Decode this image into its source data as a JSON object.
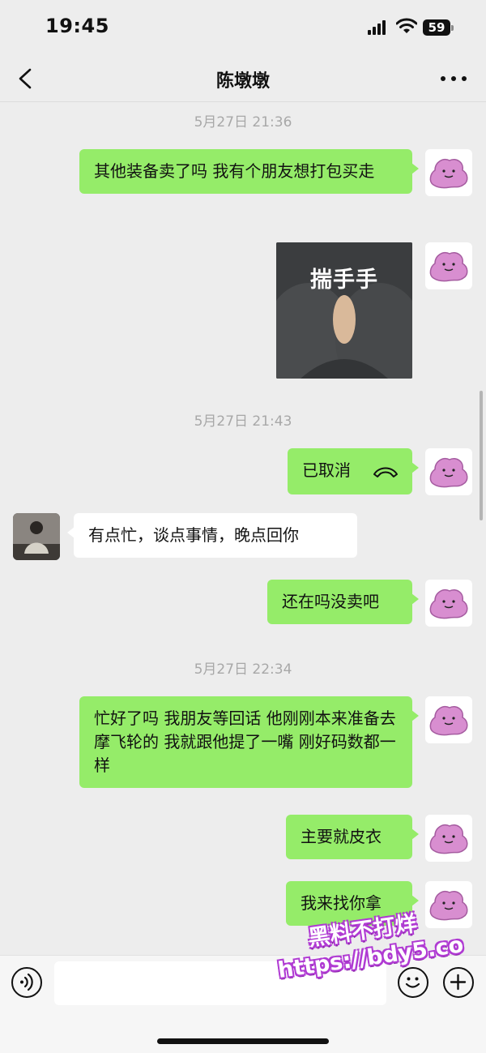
{
  "status_bar": {
    "time": "19:45",
    "battery": "59"
  },
  "nav": {
    "title": "陈墩墩"
  },
  "chat": {
    "timestamps": [
      "5月27日 21:36",
      "5月27日 21:43",
      "5月27日 22:34"
    ],
    "messages": [
      {
        "side": "out",
        "text": "其他装备卖了吗 我有个朋友想打包买走"
      },
      {
        "side": "out",
        "type": "sticker",
        "caption": "揣手手"
      },
      {
        "side": "out",
        "type": "call",
        "text": "已取消"
      },
      {
        "side": "in",
        "text": "有点忙，谈点事情，晚点回你"
      },
      {
        "side": "out",
        "text": "还在吗没卖吧"
      },
      {
        "side": "out",
        "text": "忙好了吗 我朋友等回话 他刚刚本来准备去摩飞轮的 我就跟他提了一嘴 刚好码数都一样"
      },
      {
        "side": "out",
        "text": "主要就皮衣"
      },
      {
        "side": "out",
        "text": "我来找你拿"
      }
    ]
  },
  "input": {
    "placeholder": ""
  },
  "watermark": {
    "line1": "黑料不打烊",
    "line2": "https://bdy5.co"
  },
  "colors": {
    "bubble_out": "#95ec69",
    "bubble_in": "#ffffff",
    "background": "#ededed",
    "avatar_self": "#d88ed0"
  },
  "icons": [
    "back-icon",
    "more-icon",
    "signal-icon",
    "wifi-icon",
    "battery-icon",
    "phone-hangup-icon",
    "voice-icon",
    "emoji-icon",
    "plus-icon"
  ]
}
